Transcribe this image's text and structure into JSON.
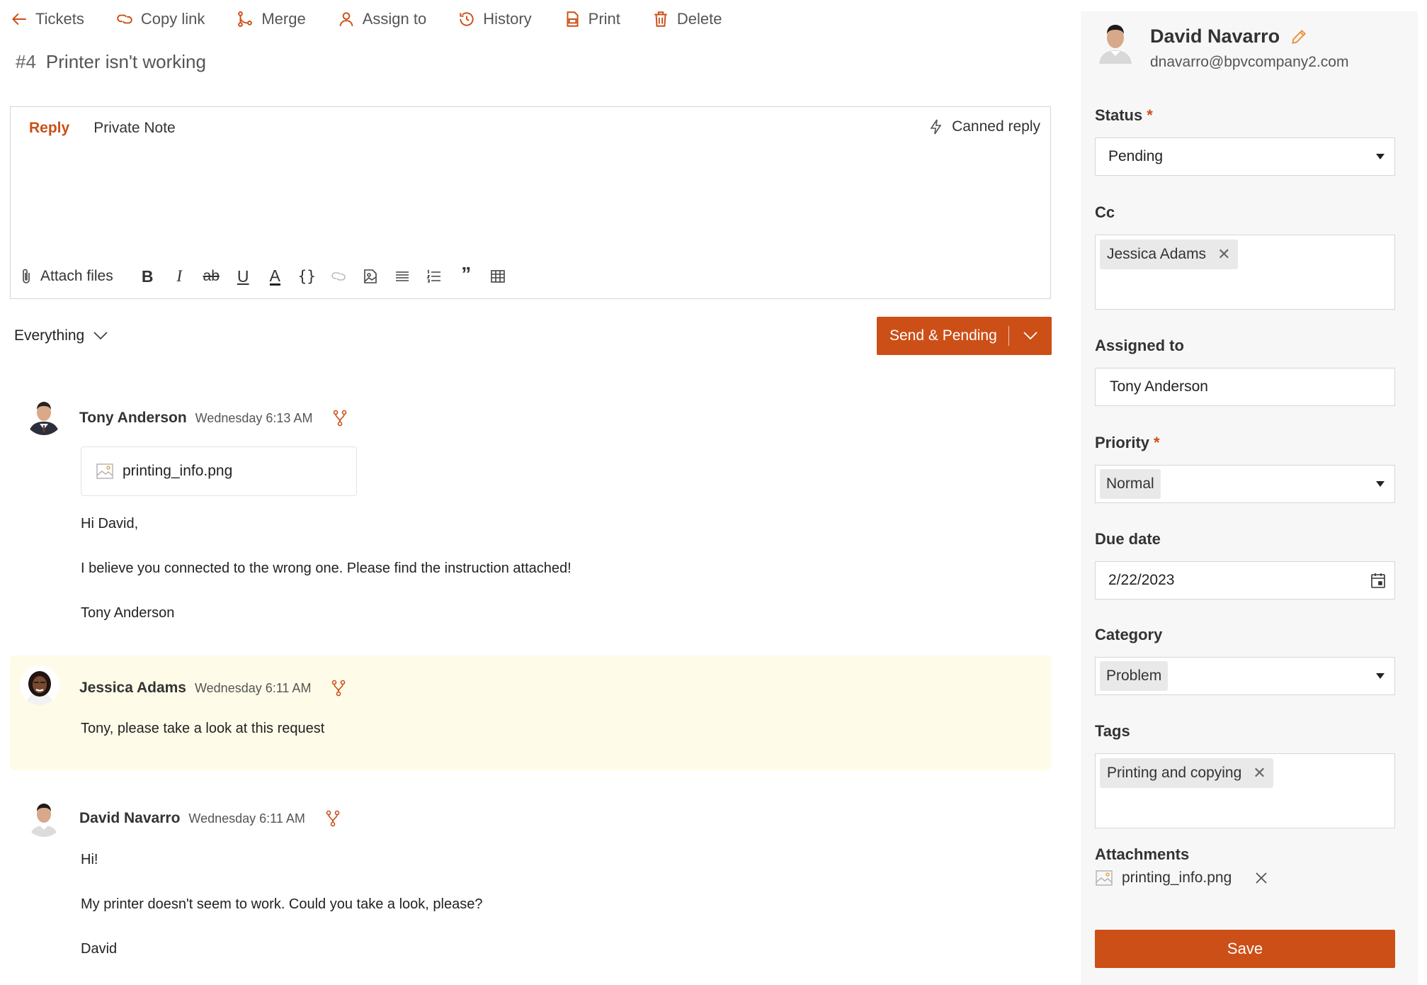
{
  "toolbar": {
    "tickets": "Tickets",
    "copy_link": "Copy link",
    "merge": "Merge",
    "assign_to": "Assign to",
    "history": "History",
    "print": "Print",
    "delete": "Delete"
  },
  "ticket": {
    "number": "#4",
    "subject": "Printer isn't working"
  },
  "composer": {
    "tab_reply": "Reply",
    "tab_private_note": "Private Note",
    "canned_reply": "Canned reply",
    "attach_files": "Attach files",
    "format_buttons": [
      "bold",
      "italic",
      "strikethrough",
      "underline",
      "text-color",
      "code",
      "link",
      "image",
      "bullet-list",
      "numbered-list",
      "quote",
      "table"
    ]
  },
  "filter": {
    "label": "Everything"
  },
  "send": {
    "label": "Send & Pending"
  },
  "messages": [
    {
      "author": "Tony Anderson",
      "time": "Wednesday 6:13 AM",
      "attachment": "printing_info.png",
      "lines": [
        "Hi David,",
        "I believe you connected to the wrong one. Please find the instruction attached!",
        "Tony Anderson"
      ]
    },
    {
      "author": "Jessica Adams",
      "time": "Wednesday 6:11 AM",
      "lines": [
        "Tony, please take a look at this request"
      ]
    },
    {
      "author": "David Navarro",
      "time": "Wednesday 6:11 AM",
      "lines": [
        "Hi!",
        "My printer doesn't seem to work. Could you take a look, please?",
        "David"
      ]
    }
  ],
  "sidebar": {
    "requester_name": "David Navarro",
    "requester_email": "dnavarro@bpvcompany2.com",
    "status_label": "Status",
    "status_value": "Pending",
    "cc_label": "Cc",
    "cc_chip": "Jessica Adams",
    "assigned_label": "Assigned to",
    "assigned_value": "Tony Anderson",
    "priority_label": "Priority",
    "priority_value": "Normal",
    "due_label": "Due date",
    "due_value": "2/22/2023",
    "category_label": "Category",
    "category_value": "Problem",
    "tags_label": "Tags",
    "tag_chip": "Printing and copying",
    "attachments_label": "Attachments",
    "attachment_file": "printing_info.png",
    "required_mark": "*",
    "save": "Save"
  },
  "colors": {
    "accent": "#cc4f17",
    "note_bg": "#fefbe8",
    "sidebar_bg": "#f7f7f7"
  }
}
